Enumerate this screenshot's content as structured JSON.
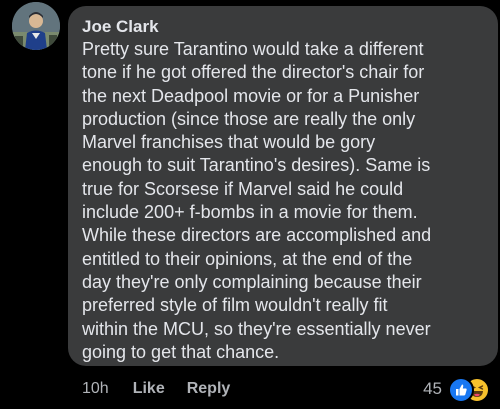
{
  "comment": {
    "author": "Joe Clark",
    "text_lines": [
      "Pretty sure Tarantino would take a different",
      "tone if he got offered the director's chair for",
      "the next Deadpool movie or for a Punisher",
      "production (since those are really the only",
      "Marvel franchises that would be gory",
      "enough to suit Tarantino's desires). Same is",
      "true for Scorsese if Marvel said he could",
      "include 200+ f-bombs in a movie for them.",
      "While these directors are accomplished and",
      "entitled to their opinions, at the end of the",
      "day they're only complaining because their",
      "preferred style of film wouldn't really fit",
      "within the MCU, so they're essentially never",
      "going to get that chance."
    ],
    "timestamp": "10h",
    "like_label": "Like",
    "reply_label": "Reply",
    "reaction_count": "45"
  },
  "reactions": [
    "like-icon",
    "haha-icon"
  ],
  "colors": {
    "background": "#000000",
    "bubble": "#3a3b3c",
    "text": "#e4e6eb",
    "secondary_text": "#b0b3b8",
    "like_blue": "#1877f2",
    "haha_yellow": "#f7c12c"
  }
}
